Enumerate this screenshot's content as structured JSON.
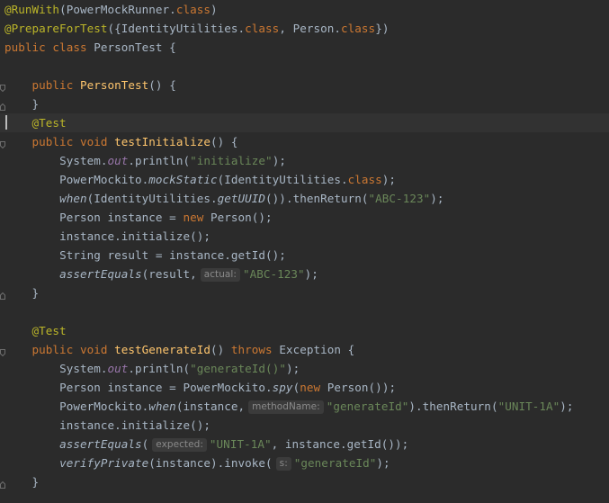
{
  "code": {
    "l1": {
      "a1": "@RunWith",
      "p1": "(PowerMockRunner.",
      "k1": "class",
      "p2": ")"
    },
    "l2": {
      "a1": "@PrepareForTest",
      "p1": "({IdentityUtilities.",
      "k1": "class",
      "p2": ", Person.",
      "k2": "class",
      "p3": "})"
    },
    "l3": {
      "k1": "public class",
      "p1": " PersonTest {"
    },
    "l5": {
      "k1": "public",
      "f1": "PersonTest",
      "p1": "() {"
    },
    "l6": {
      "p1": "}"
    },
    "l7": {
      "a1": "@Test"
    },
    "l8": {
      "k1": "public void",
      "f1": "testInitialize",
      "p1": "() {"
    },
    "l9": {
      "p1": "System.",
      "fld": "out",
      "p2": ".println(",
      "s1": "\"initialize\"",
      "p3": ");"
    },
    "l10": {
      "p1": "PowerMockito.",
      "i1": "mockStatic",
      "p2": "(IdentityUtilities.",
      "k1": "class",
      "p3": ");"
    },
    "l11": {
      "i1": "when",
      "p1": "(IdentityUtilities.",
      "i2": "getUUID",
      "p2": "()).thenReturn(",
      "s1": "\"ABC-123\"",
      "p3": ");"
    },
    "l12": {
      "p1": "Person instance = ",
      "k1": "new",
      "p2": " Person();"
    },
    "l13": {
      "p1": "instance.initialize();"
    },
    "l14": {
      "p1": "String result = instance.getId();"
    },
    "l15": {
      "i1": "assertEquals",
      "p1": "(result,",
      "h1": "actual:",
      "s1": "\"ABC-123\"",
      "p2": ");"
    },
    "l16": {
      "p1": "}"
    },
    "l18": {
      "a1": "@Test"
    },
    "l19": {
      "k1": "public void",
      "f1": "testGenerateId",
      "p1": "() ",
      "k2": "throws",
      "p2": " Exception {"
    },
    "l20": {
      "p1": "System.",
      "fld": "out",
      "p2": ".println(",
      "s1": "\"generateId()\"",
      "p3": ");"
    },
    "l21": {
      "p1": "Person instance = PowerMockito.",
      "i1": "spy",
      "p2": "(",
      "k1": "new",
      "p3": " Person());"
    },
    "l22": {
      "p1": "PowerMockito.",
      "i1": "when",
      "p2": "(instance,",
      "h1": "methodName:",
      "s1": "\"generateId\"",
      "p3": ").thenReturn(",
      "s2": "\"UNIT-1A\"",
      "p4": ");"
    },
    "l23": {
      "p1": "instance.initialize();"
    },
    "l24": {
      "i1": "assertEquals",
      "p1": "(",
      "h1": "expected:",
      "s1": "\"UNIT-1A\"",
      "p2": ", instance.getId());"
    },
    "l25": {
      "i1": "verifyPrivate",
      "p1": "(instance).invoke(",
      "h1": "s:",
      "s1": "\"generateId\"",
      "p2": ");"
    },
    "l26": {
      "p1": "}"
    }
  },
  "colors": {
    "background": "#2b2b2b",
    "annotation": "#bbb529",
    "keyword": "#cc7832",
    "method_decl": "#ffc66d",
    "string": "#6a8759",
    "field": "#9876aa",
    "text": "#a9b7c6"
  },
  "icons": [
    "fold-marker-icon"
  ]
}
